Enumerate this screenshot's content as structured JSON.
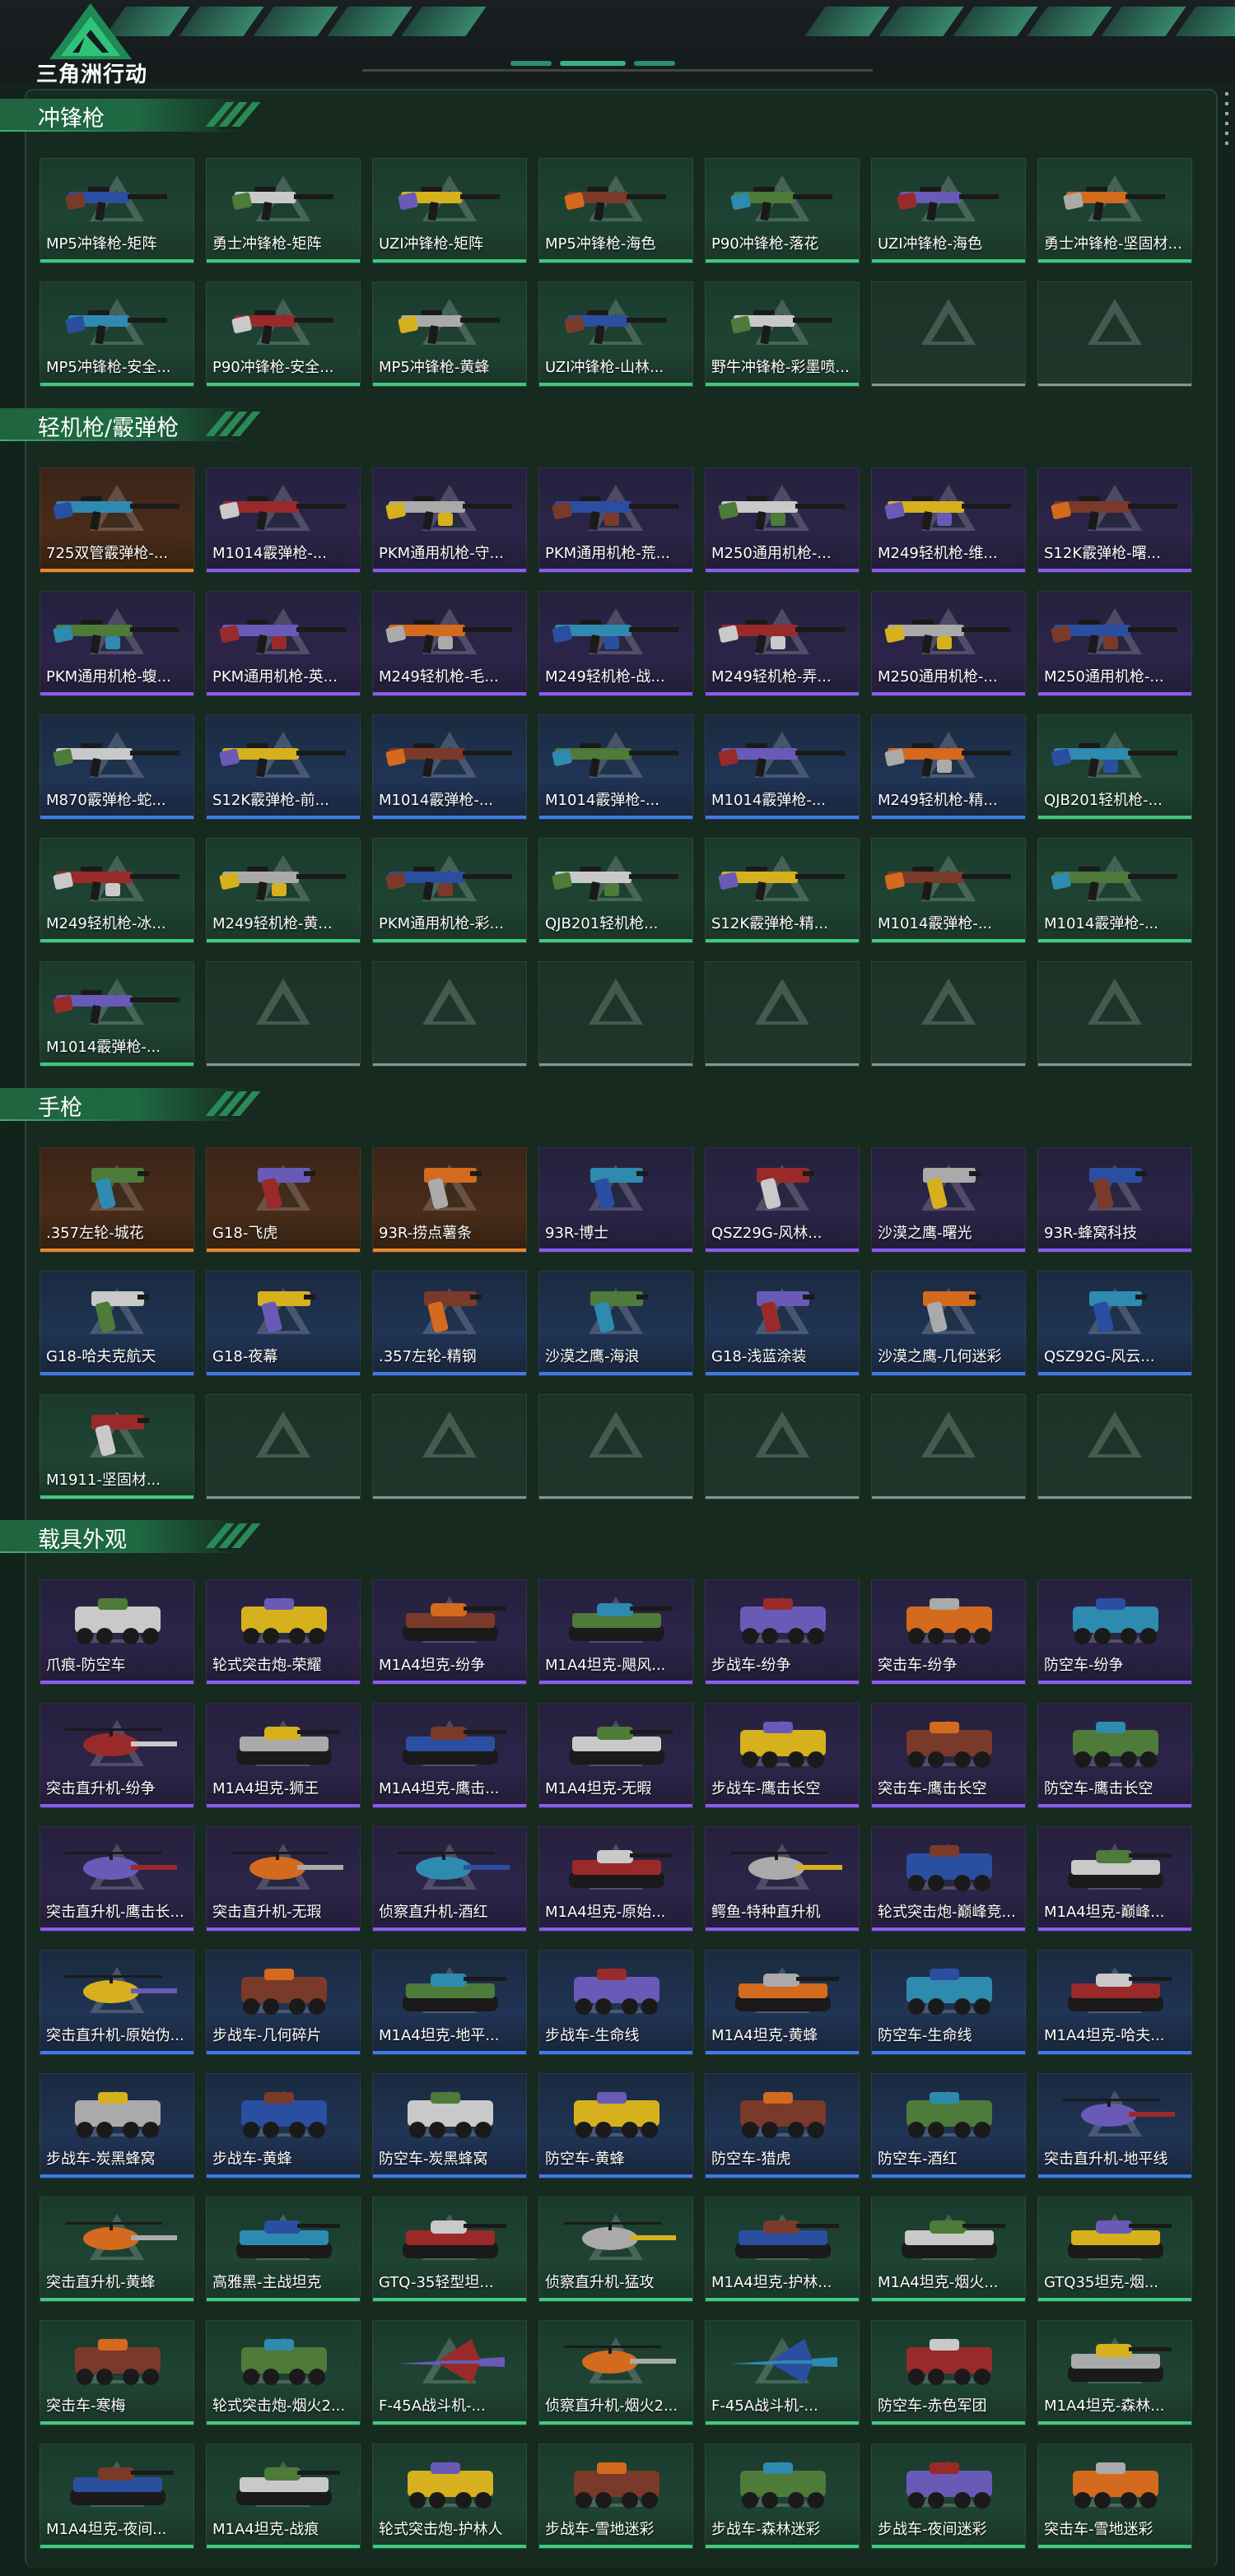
{
  "header": {
    "logo_text": "三角洲行动",
    "colors": {
      "accent": "#3fc97c",
      "background": "#13231b"
    }
  },
  "sections": [
    {
      "title": "冲锋枪",
      "items": [
        {
          "label": "MP5冲锋枪-矩阵",
          "rarity": "green",
          "icon": "smg-icon"
        },
        {
          "label": "勇士冲锋枪-矩阵",
          "rarity": "green",
          "icon": "smg-icon"
        },
        {
          "label": "UZI冲锋枪-矩阵",
          "rarity": "green",
          "icon": "smg-icon"
        },
        {
          "label": "MP5冲锋枪-海色",
          "rarity": "green",
          "icon": "smg-icon"
        },
        {
          "label": "P90冲锋枪-落花",
          "rarity": "green",
          "icon": "smg-icon"
        },
        {
          "label": "UZI冲锋枪-海色",
          "rarity": "green",
          "icon": "smg-icon"
        },
        {
          "label": "勇士冲锋枪-坚固材...",
          "rarity": "green",
          "icon": "smg-icon"
        },
        {
          "label": "MP5冲锋枪-安全...",
          "rarity": "green",
          "icon": "smg-icon"
        },
        {
          "label": "P90冲锋枪-安全...",
          "rarity": "green",
          "icon": "smg-icon"
        },
        {
          "label": "MP5冲锋枪-黄蜂",
          "rarity": "green",
          "icon": "smg-icon"
        },
        {
          "label": "UZI冲锋枪-山林...",
          "rarity": "green",
          "icon": "smg-icon"
        },
        {
          "label": "野牛冲锋枪-彩墨喷...",
          "rarity": "green",
          "icon": "smg-icon"
        },
        {
          "label": "",
          "rarity": "empty",
          "icon": "empty-slot-icon"
        },
        {
          "label": "",
          "rarity": "empty",
          "icon": "empty-slot-icon"
        }
      ]
    },
    {
      "title": "轻机枪/霰弹枪",
      "items": [
        {
          "label": "725双管霰弹枪-...",
          "rarity": "orange",
          "icon": "shotgun-icon"
        },
        {
          "label": "M1014霰弹枪-...",
          "rarity": "purple",
          "icon": "shotgun-icon"
        },
        {
          "label": "PKM通用机枪-守...",
          "rarity": "purple",
          "icon": "lmg-icon"
        },
        {
          "label": "PKM通用机枪-荒...",
          "rarity": "purple",
          "icon": "lmg-icon"
        },
        {
          "label": "M250通用机枪-...",
          "rarity": "purple",
          "icon": "lmg-icon"
        },
        {
          "label": "M249轻机枪-维...",
          "rarity": "purple",
          "icon": "lmg-icon"
        },
        {
          "label": "S12K霰弹枪-曙...",
          "rarity": "purple",
          "icon": "shotgun-icon"
        },
        {
          "label": "PKM通用机枪-蝮...",
          "rarity": "purple",
          "icon": "lmg-icon"
        },
        {
          "label": "PKM通用机枪-英...",
          "rarity": "purple",
          "icon": "lmg-icon"
        },
        {
          "label": "M249轻机枪-毛...",
          "rarity": "purple",
          "icon": "lmg-icon"
        },
        {
          "label": "M249轻机枪-战...",
          "rarity": "purple",
          "icon": "lmg-icon"
        },
        {
          "label": "M249轻机枪-弄...",
          "rarity": "purple",
          "icon": "lmg-icon"
        },
        {
          "label": "M250通用机枪-...",
          "rarity": "purple",
          "icon": "lmg-icon"
        },
        {
          "label": "M250通用机枪-...",
          "rarity": "purple",
          "icon": "lmg-icon"
        },
        {
          "label": "M870霰弹枪-蛇...",
          "rarity": "blue",
          "icon": "shotgun-icon"
        },
        {
          "label": "S12K霰弹枪-前...",
          "rarity": "blue",
          "icon": "shotgun-icon"
        },
        {
          "label": "M1014霰弹枪-...",
          "rarity": "blue",
          "icon": "shotgun-icon"
        },
        {
          "label": "M1014霰弹枪-...",
          "rarity": "blue",
          "icon": "shotgun-icon"
        },
        {
          "label": "M1014霰弹枪-...",
          "rarity": "blue",
          "icon": "shotgun-icon"
        },
        {
          "label": "M249轻机枪-精...",
          "rarity": "blue",
          "icon": "lmg-icon"
        },
        {
          "label": "QJB201轻机枪-...",
          "rarity": "green",
          "icon": "lmg-icon"
        },
        {
          "label": "M249轻机枪-冰...",
          "rarity": "green",
          "icon": "lmg-icon"
        },
        {
          "label": "M249轻机枪-黄...",
          "rarity": "green",
          "icon": "lmg-icon"
        },
        {
          "label": "PKM通用机枪-彩...",
          "rarity": "green",
          "icon": "lmg-icon"
        },
        {
          "label": "QJB201轻机枪...",
          "rarity": "green",
          "icon": "lmg-icon"
        },
        {
          "label": "S12K霰弹枪-精...",
          "rarity": "green",
          "icon": "shotgun-icon"
        },
        {
          "label": "M1014霰弹枪-...",
          "rarity": "green",
          "icon": "shotgun-icon"
        },
        {
          "label": "M1014霰弹枪-...",
          "rarity": "green",
          "icon": "shotgun-icon"
        },
        {
          "label": "M1014霰弹枪-...",
          "rarity": "green",
          "icon": "shotgun-icon"
        },
        {
          "label": "",
          "rarity": "empty",
          "icon": "empty-slot-icon"
        },
        {
          "label": "",
          "rarity": "empty",
          "icon": "empty-slot-icon"
        },
        {
          "label": "",
          "rarity": "empty",
          "icon": "empty-slot-icon"
        },
        {
          "label": "",
          "rarity": "empty",
          "icon": "empty-slot-icon"
        },
        {
          "label": "",
          "rarity": "empty",
          "icon": "empty-slot-icon"
        },
        {
          "label": "",
          "rarity": "empty",
          "icon": "empty-slot-icon"
        }
      ]
    },
    {
      "title": "手枪",
      "items": [
        {
          "label": ".357左轮-城花",
          "rarity": "orange",
          "icon": "pistol-icon"
        },
        {
          "label": "G18-飞虎",
          "rarity": "orange",
          "icon": "pistol-icon"
        },
        {
          "label": "93R-捞点薯条",
          "rarity": "orange",
          "icon": "pistol-icon"
        },
        {
          "label": "93R-博士",
          "rarity": "purple",
          "icon": "pistol-icon"
        },
        {
          "label": "QSZ29G-风林...",
          "rarity": "purple",
          "icon": "pistol-icon"
        },
        {
          "label": "沙漠之鹰-曙光",
          "rarity": "purple",
          "icon": "pistol-icon"
        },
        {
          "label": "93R-蜂窝科技",
          "rarity": "purple",
          "icon": "pistol-icon"
        },
        {
          "label": "G18-哈夫克航天",
          "rarity": "blue",
          "icon": "pistol-icon"
        },
        {
          "label": "G18-夜幕",
          "rarity": "blue",
          "icon": "pistol-icon"
        },
        {
          "label": ".357左轮-精钢",
          "rarity": "blue",
          "icon": "pistol-icon"
        },
        {
          "label": "沙漠之鹰-海浪",
          "rarity": "blue",
          "icon": "pistol-icon"
        },
        {
          "label": "G18-浅蓝涂装",
          "rarity": "blue",
          "icon": "pistol-icon"
        },
        {
          "label": "沙漠之鹰-几何迷彩",
          "rarity": "blue",
          "icon": "pistol-icon"
        },
        {
          "label": "QSZ92G-风云...",
          "rarity": "blue",
          "icon": "pistol-icon"
        },
        {
          "label": "M1911-坚固材...",
          "rarity": "green",
          "icon": "pistol-icon"
        },
        {
          "label": "",
          "rarity": "empty",
          "icon": "empty-slot-icon"
        },
        {
          "label": "",
          "rarity": "empty",
          "icon": "empty-slot-icon"
        },
        {
          "label": "",
          "rarity": "empty",
          "icon": "empty-slot-icon"
        },
        {
          "label": "",
          "rarity": "empty",
          "icon": "empty-slot-icon"
        },
        {
          "label": "",
          "rarity": "empty",
          "icon": "empty-slot-icon"
        },
        {
          "label": "",
          "rarity": "empty",
          "icon": "empty-slot-icon"
        }
      ]
    },
    {
      "title": "载具外观",
      "items": [
        {
          "label": "爪痕-防空车",
          "rarity": "purple",
          "icon": "apc-icon"
        },
        {
          "label": "轮式突击炮-荣耀",
          "rarity": "purple",
          "icon": "apc-icon"
        },
        {
          "label": "M1A4坦克-纷争",
          "rarity": "purple",
          "icon": "tank-icon"
        },
        {
          "label": "M1A4坦克-飓风...",
          "rarity": "purple",
          "icon": "tank-icon"
        },
        {
          "label": "步战车-纷争",
          "rarity": "purple",
          "icon": "apc-icon"
        },
        {
          "label": "突击车-纷争",
          "rarity": "purple",
          "icon": "jeep-icon"
        },
        {
          "label": "防空车-纷争",
          "rarity": "purple",
          "icon": "apc-icon"
        },
        {
          "label": "突击直升机-纷争",
          "rarity": "purple",
          "icon": "helicopter-icon"
        },
        {
          "label": "M1A4坦克-狮王",
          "rarity": "purple",
          "icon": "tank-icon"
        },
        {
          "label": "M1A4坦克-鹰击...",
          "rarity": "purple",
          "icon": "tank-icon"
        },
        {
          "label": "M1A4坦克-无暇",
          "rarity": "purple",
          "icon": "tank-icon"
        },
        {
          "label": "步战车-鹰击长空",
          "rarity": "purple",
          "icon": "apc-icon"
        },
        {
          "label": "突击车-鹰击长空",
          "rarity": "purple",
          "icon": "jeep-icon"
        },
        {
          "label": "防空车-鹰击长空",
          "rarity": "purple",
          "icon": "apc-icon"
        },
        {
          "label": "突击直升机-鹰击长...",
          "rarity": "purple",
          "icon": "helicopter-icon"
        },
        {
          "label": "突击直升机-无瑕",
          "rarity": "purple",
          "icon": "helicopter-icon"
        },
        {
          "label": "侦察直升机-酒红",
          "rarity": "purple",
          "icon": "helicopter-icon"
        },
        {
          "label": "M1A4坦克-原始...",
          "rarity": "purple",
          "icon": "tank-icon"
        },
        {
          "label": "鳄鱼-特种直升机",
          "rarity": "purple",
          "icon": "helicopter-icon"
        },
        {
          "label": "轮式突击炮-巅峰竞...",
          "rarity": "purple",
          "icon": "apc-icon"
        },
        {
          "label": "M1A4坦克-巅峰...",
          "rarity": "purple",
          "icon": "tank-icon"
        },
        {
          "label": "突击直升机-原始伪...",
          "rarity": "blue",
          "icon": "helicopter-icon"
        },
        {
          "label": "步战车-几何碎片",
          "rarity": "blue",
          "icon": "apc-icon"
        },
        {
          "label": "M1A4坦克-地平...",
          "rarity": "blue",
          "icon": "tank-icon"
        },
        {
          "label": "步战车-生命线",
          "rarity": "blue",
          "icon": "apc-icon"
        },
        {
          "label": "M1A4坦克-黄蜂",
          "rarity": "blue",
          "icon": "tank-icon"
        },
        {
          "label": "防空车-生命线",
          "rarity": "blue",
          "icon": "apc-icon"
        },
        {
          "label": "M1A4坦克-哈夫...",
          "rarity": "blue",
          "icon": "tank-icon"
        },
        {
          "label": "步战车-炭黑蜂窝",
          "rarity": "blue",
          "icon": "apc-icon"
        },
        {
          "label": "步战车-黄蜂",
          "rarity": "blue",
          "icon": "apc-icon"
        },
        {
          "label": "防空车-炭黑蜂窝",
          "rarity": "blue",
          "icon": "apc-icon"
        },
        {
          "label": "防空车-黄蜂",
          "rarity": "blue",
          "icon": "apc-icon"
        },
        {
          "label": "防空车-猎虎",
          "rarity": "blue",
          "icon": "apc-icon"
        },
        {
          "label": "防空车-酒红",
          "rarity": "blue",
          "icon": "apc-icon"
        },
        {
          "label": "突击直升机-地平线",
          "rarity": "blue",
          "icon": "helicopter-icon"
        },
        {
          "label": "突击直升机-黄蜂",
          "rarity": "green",
          "icon": "helicopter-icon"
        },
        {
          "label": "高雅黑-主战坦克",
          "rarity": "green",
          "icon": "tank-icon"
        },
        {
          "label": "GTQ-35轻型坦...",
          "rarity": "green",
          "icon": "tank-icon"
        },
        {
          "label": "侦察直升机-猛攻",
          "rarity": "green",
          "icon": "helicopter-icon"
        },
        {
          "label": "M1A4坦克-护林...",
          "rarity": "green",
          "icon": "tank-icon"
        },
        {
          "label": "M1A4坦克-烟火...",
          "rarity": "green",
          "icon": "tank-icon"
        },
        {
          "label": "GTQ35坦克-烟...",
          "rarity": "green",
          "icon": "tank-icon"
        },
        {
          "label": "突击车-寒梅",
          "rarity": "green",
          "icon": "jeep-icon"
        },
        {
          "label": "轮式突击炮-烟火2...",
          "rarity": "green",
          "icon": "apc-icon"
        },
        {
          "label": "F-45A战斗机-...",
          "rarity": "green",
          "icon": "jet-icon"
        },
        {
          "label": "侦察直升机-烟火2...",
          "rarity": "green",
          "icon": "helicopter-icon"
        },
        {
          "label": "F-45A战斗机-...",
          "rarity": "green",
          "icon": "jet-icon"
        },
        {
          "label": "防空车-赤色军团",
          "rarity": "green",
          "icon": "apc-icon"
        },
        {
          "label": "M1A4坦克-森林...",
          "rarity": "green",
          "icon": "tank-icon"
        },
        {
          "label": "M1A4坦克-夜间...",
          "rarity": "green",
          "icon": "tank-icon"
        },
        {
          "label": "M1A4坦克-战痕",
          "rarity": "green",
          "icon": "tank-icon"
        },
        {
          "label": "轮式突击炮-护林人",
          "rarity": "green",
          "icon": "apc-icon"
        },
        {
          "label": "步战车-雪地迷彩",
          "rarity": "green",
          "icon": "apc-icon"
        },
        {
          "label": "步战车-森林迷彩",
          "rarity": "green",
          "icon": "apc-icon"
        },
        {
          "label": "步战车-夜间迷彩",
          "rarity": "green",
          "icon": "apc-icon"
        },
        {
          "label": "突击车-雪地迷彩",
          "rarity": "green",
          "icon": "jeep-icon"
        }
      ]
    }
  ]
}
